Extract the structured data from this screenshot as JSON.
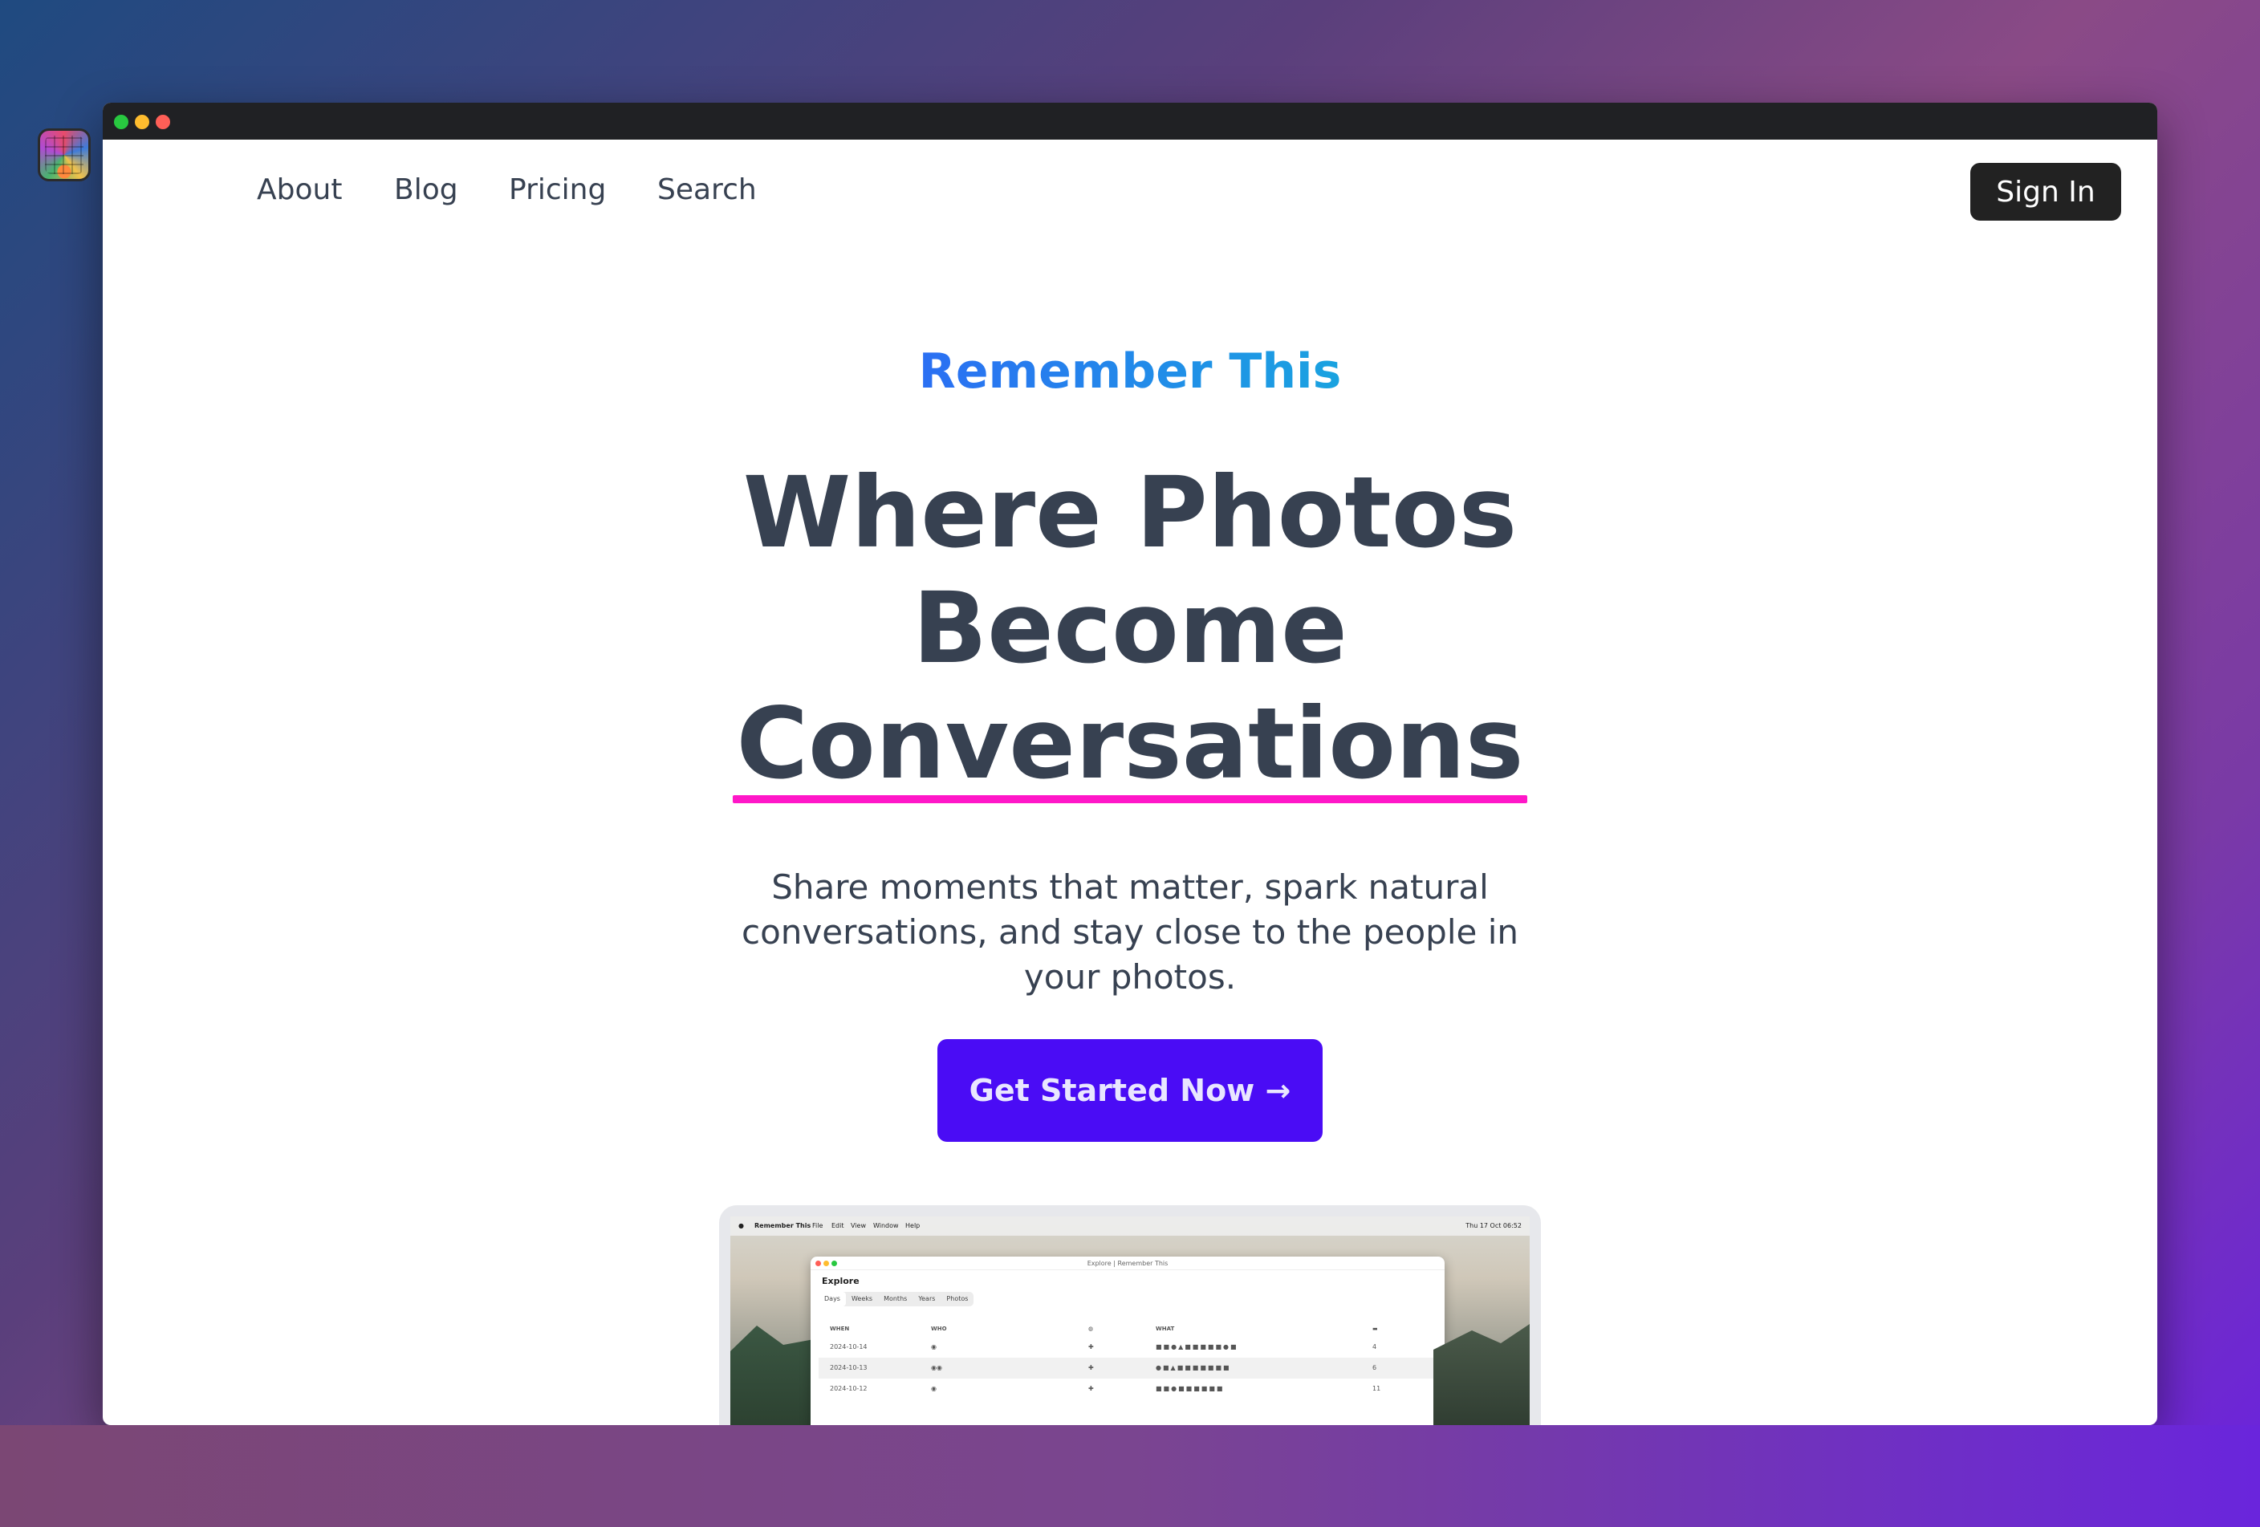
{
  "window": {
    "controls": [
      "close",
      "minimize",
      "zoom"
    ]
  },
  "nav": {
    "logo_icon": "app-logo-icon",
    "links": [
      {
        "label": "About"
      },
      {
        "label": "Blog"
      },
      {
        "label": "Pricing"
      },
      {
        "label": "Search"
      }
    ],
    "signin_label": "Sign In"
  },
  "hero": {
    "eyebrow": "Remember This",
    "headline_line1": "Where Photos",
    "headline_line2": "Become",
    "headline_line3": "Conversations",
    "subtext": "Share moments that matter, spark natural conversations, and stay close to the people in your photos.",
    "cta_label": "Get Started Now →"
  },
  "colors": {
    "accent_button": "#4a0cf5",
    "underline": "#ff17c8",
    "eyebrow_gradient_start": "#2b6ff3",
    "eyebrow_gradient_end": "#1aa3e0"
  },
  "preview": {
    "menubar": {
      "app": "Remember This",
      "items": [
        "File",
        "Edit",
        "View",
        "Window",
        "Help"
      ],
      "clock": "Thu 17 Oct 06:52"
    },
    "window_title": "Explore | Remember This",
    "section_title": "Explore",
    "tabs": [
      "Days",
      "Weeks",
      "Months",
      "Years",
      "Photos"
    ],
    "active_tab": "Days",
    "columns": [
      "WHEN",
      "WHO",
      "",
      "WHAT",
      ""
    ],
    "rows": [
      {
        "when": "2024-10-14",
        "count": "4"
      },
      {
        "when": "2024-10-13",
        "count": "6"
      },
      {
        "when": "2024-10-12",
        "count": "11"
      }
    ]
  }
}
